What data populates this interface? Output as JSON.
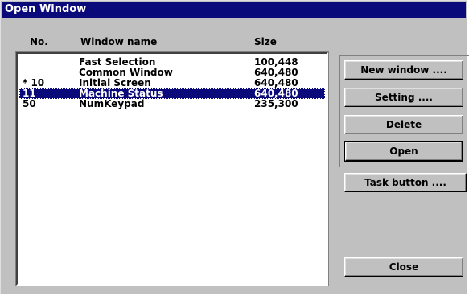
{
  "window": {
    "title": "Open Window"
  },
  "list": {
    "headers": {
      "no": "No.",
      "name": "Window name",
      "size": "Size"
    },
    "rows": [
      {
        "no": "",
        "name": "Fast Selection",
        "size": "100,448",
        "selected": false
      },
      {
        "no": "",
        "name": "Common Window",
        "size": "640,480",
        "selected": false
      },
      {
        "no": "* 10",
        "name": "Initial Screen",
        "size": "640,480",
        "selected": false
      },
      {
        "no": "11",
        "name": "Machine Status",
        "size": "640,480",
        "selected": true
      },
      {
        "no": "50",
        "name": "NumKeypad",
        "size": "235,300",
        "selected": false
      }
    ]
  },
  "buttons": {
    "new_window": "New window ....",
    "setting": "Setting ....",
    "delete": "Delete",
    "open": "Open",
    "task_button": "Task button ....",
    "close": "Close"
  },
  "colors": {
    "titlebar": "#0a0a7a",
    "selection": "#0a0a7a",
    "face": "#c0c0c0"
  }
}
